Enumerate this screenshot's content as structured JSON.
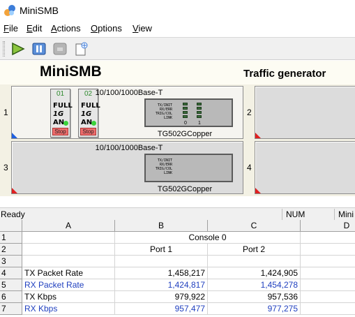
{
  "window": {
    "title": "MiniSMB"
  },
  "menu": {
    "items": [
      {
        "label": "File",
        "key": "F",
        "rest": "ile"
      },
      {
        "label": "Edit",
        "key": "E",
        "rest": "dit"
      },
      {
        "label": "Actions",
        "key": "A",
        "rest": "ctions"
      },
      {
        "label": "Options",
        "key": "O",
        "rest": "ptions"
      },
      {
        "label": "View",
        "key": "V",
        "rest": "iew"
      }
    ]
  },
  "toolbar": {
    "buttons": [
      {
        "icon": "play-icon"
      },
      {
        "icon": "pause-icon"
      },
      {
        "icon": "disabled-icon"
      },
      {
        "icon": "new-document-icon"
      }
    ]
  },
  "banner": {
    "title": "MiniSMB",
    "subtitle": "Traffic generator"
  },
  "slots": [
    {
      "number": "1",
      "card_title": "10/100/1000Base-T",
      "model": "TG502GCopper",
      "active": true,
      "ports": [
        {
          "id": "01",
          "line1": "FULL",
          "line2": "1G",
          "line3": "AN",
          "stop": "Stop"
        },
        {
          "id": "02",
          "line1": "FULL",
          "line2": "1G",
          "line3": "AN",
          "stop": "Stop"
        }
      ],
      "led_labels": [
        "TX/INIT",
        "RX/ERR",
        "TRIG/COL",
        "LINK"
      ],
      "led_indices": [
        "0",
        "1"
      ]
    },
    {
      "number": "2"
    },
    {
      "number": "3",
      "card_title": "10/100/1000Base-T",
      "model": "TG502GCopper",
      "active": false,
      "led_labels": [
        "TX/INIT",
        "RX/ERR",
        "TRIG/COL",
        "LINK"
      ]
    },
    {
      "number": "4"
    }
  ],
  "status": {
    "text": "Ready",
    "num": "NUM",
    "mini": "Mini"
  },
  "sheet": {
    "columns": [
      "A",
      "B",
      "C",
      "D"
    ],
    "rows": [
      {
        "n": "1",
        "a": "",
        "b": "Console 0",
        "c": ""
      },
      {
        "n": "2",
        "a": "",
        "b": "Port 1",
        "c": "Port 2"
      },
      {
        "n": "3",
        "a": "",
        "b": "",
        "c": ""
      },
      {
        "n": "4",
        "a": "TX Packet Rate",
        "b": "1,458,217",
        "c": "1,424,905",
        "color": "black"
      },
      {
        "n": "5",
        "a": "RX Packet Rate",
        "b": "1,424,817",
        "c": "1,454,278",
        "color": "blue"
      },
      {
        "n": "6",
        "a": "TX Kbps",
        "b": "979,922",
        "c": "957,536",
        "color": "black"
      },
      {
        "n": "7",
        "a": "RX Kbps",
        "b": "957,477",
        "c": "977,275",
        "color": "blue"
      }
    ]
  },
  "colors": {
    "rx_text": "#1f3fbf",
    "stop_button": "#ef6d6d",
    "led_green": "#3bd23b",
    "banner_bg": "#fdfcf3"
  }
}
